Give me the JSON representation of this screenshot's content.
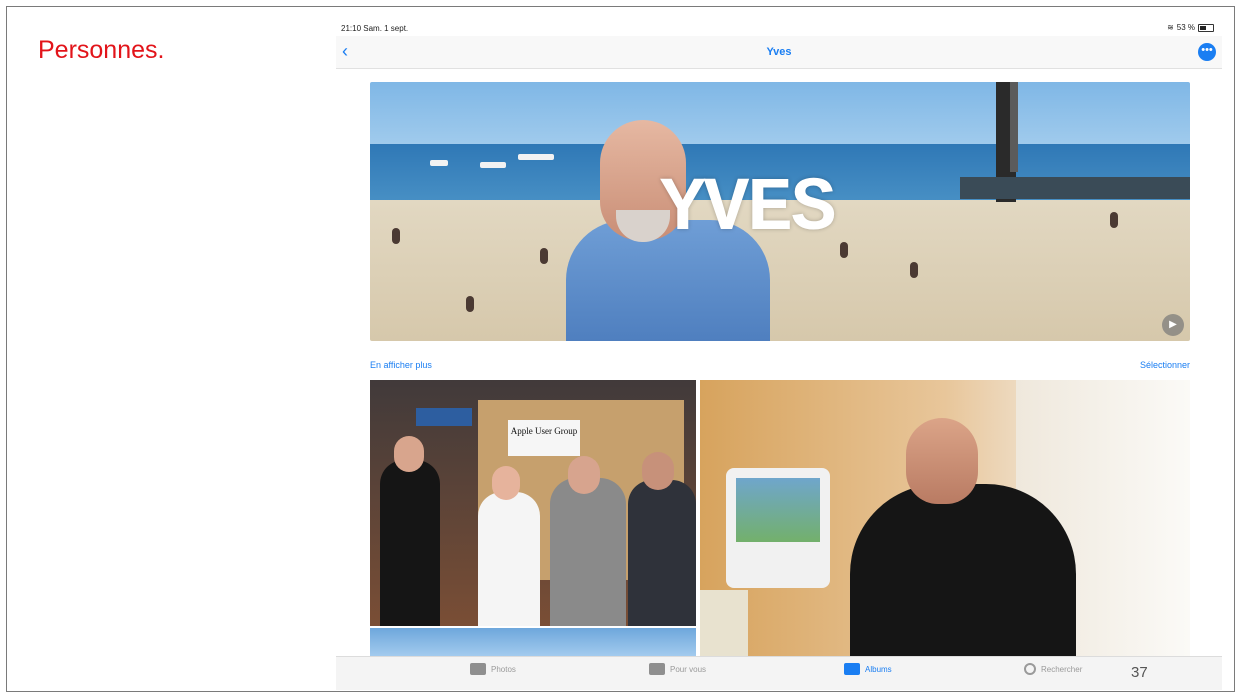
{
  "slide": {
    "title": "Personnes.",
    "page_number": "37"
  },
  "status_bar": {
    "time": "21:10  Sam. 1 sept.",
    "battery": "53 %"
  },
  "navbar": {
    "title": "Yves",
    "back_icon": "chevron-left-icon",
    "more_icon": "ellipsis-circle-icon"
  },
  "hero": {
    "overlay_text": "YVES",
    "play_icon": "play-icon"
  },
  "links": {
    "show_more": "En afficher plus",
    "select": "Sélectionner"
  },
  "photos": {
    "booth_sign": "Apple User Group"
  },
  "tabbar": {
    "items": [
      "Photos",
      "Pour vous",
      "Albums",
      "Rechercher"
    ],
    "active": "Albums"
  },
  "colors": {
    "accent": "#1a7ef2",
    "title_red": "#e2141a"
  }
}
